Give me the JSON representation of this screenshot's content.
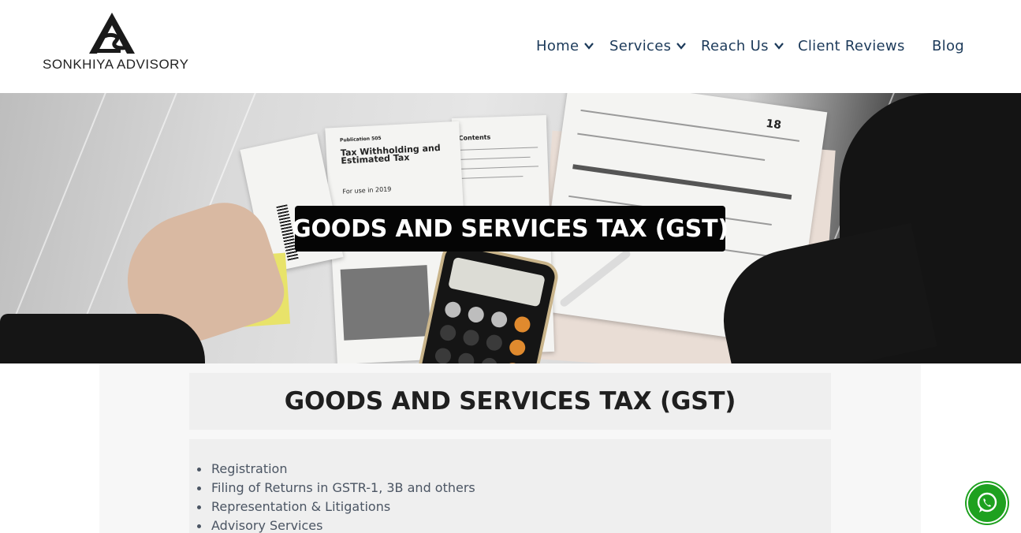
{
  "brand": {
    "name": "SONKHIYA ADVISORY",
    "logo_icon": "sa-monogram-icon"
  },
  "nav": {
    "items": [
      {
        "label": "Home",
        "has_dropdown": true
      },
      {
        "label": "Services",
        "has_dropdown": true
      },
      {
        "label": "Reach Us",
        "has_dropdown": true
      },
      {
        "label": "Client Reviews",
        "has_dropdown": false
      },
      {
        "label": "Blog",
        "has_dropdown": false
      }
    ],
    "color": "#1c3a5a"
  },
  "hero": {
    "title": "GOODS AND SERVICES TAX (GST)",
    "image_subject": "tax-documents-calculator-photo",
    "document_text": {
      "publication": "Publication 505",
      "heading": "Tax Withholding and Estimated Tax",
      "year_note": "For use in 2019",
      "contents": "Contents",
      "form_number": "18"
    }
  },
  "main": {
    "heading": "GOODS AND SERVICES TAX (GST)",
    "services": [
      "Registration",
      "Filing of Returns in GSTR-1, 3B and others",
      "Representation & Litigations",
      "Advisory Services"
    ]
  },
  "floating": {
    "whatsapp_icon": "whatsapp-icon",
    "whatsapp_color": "#1ea11f"
  }
}
